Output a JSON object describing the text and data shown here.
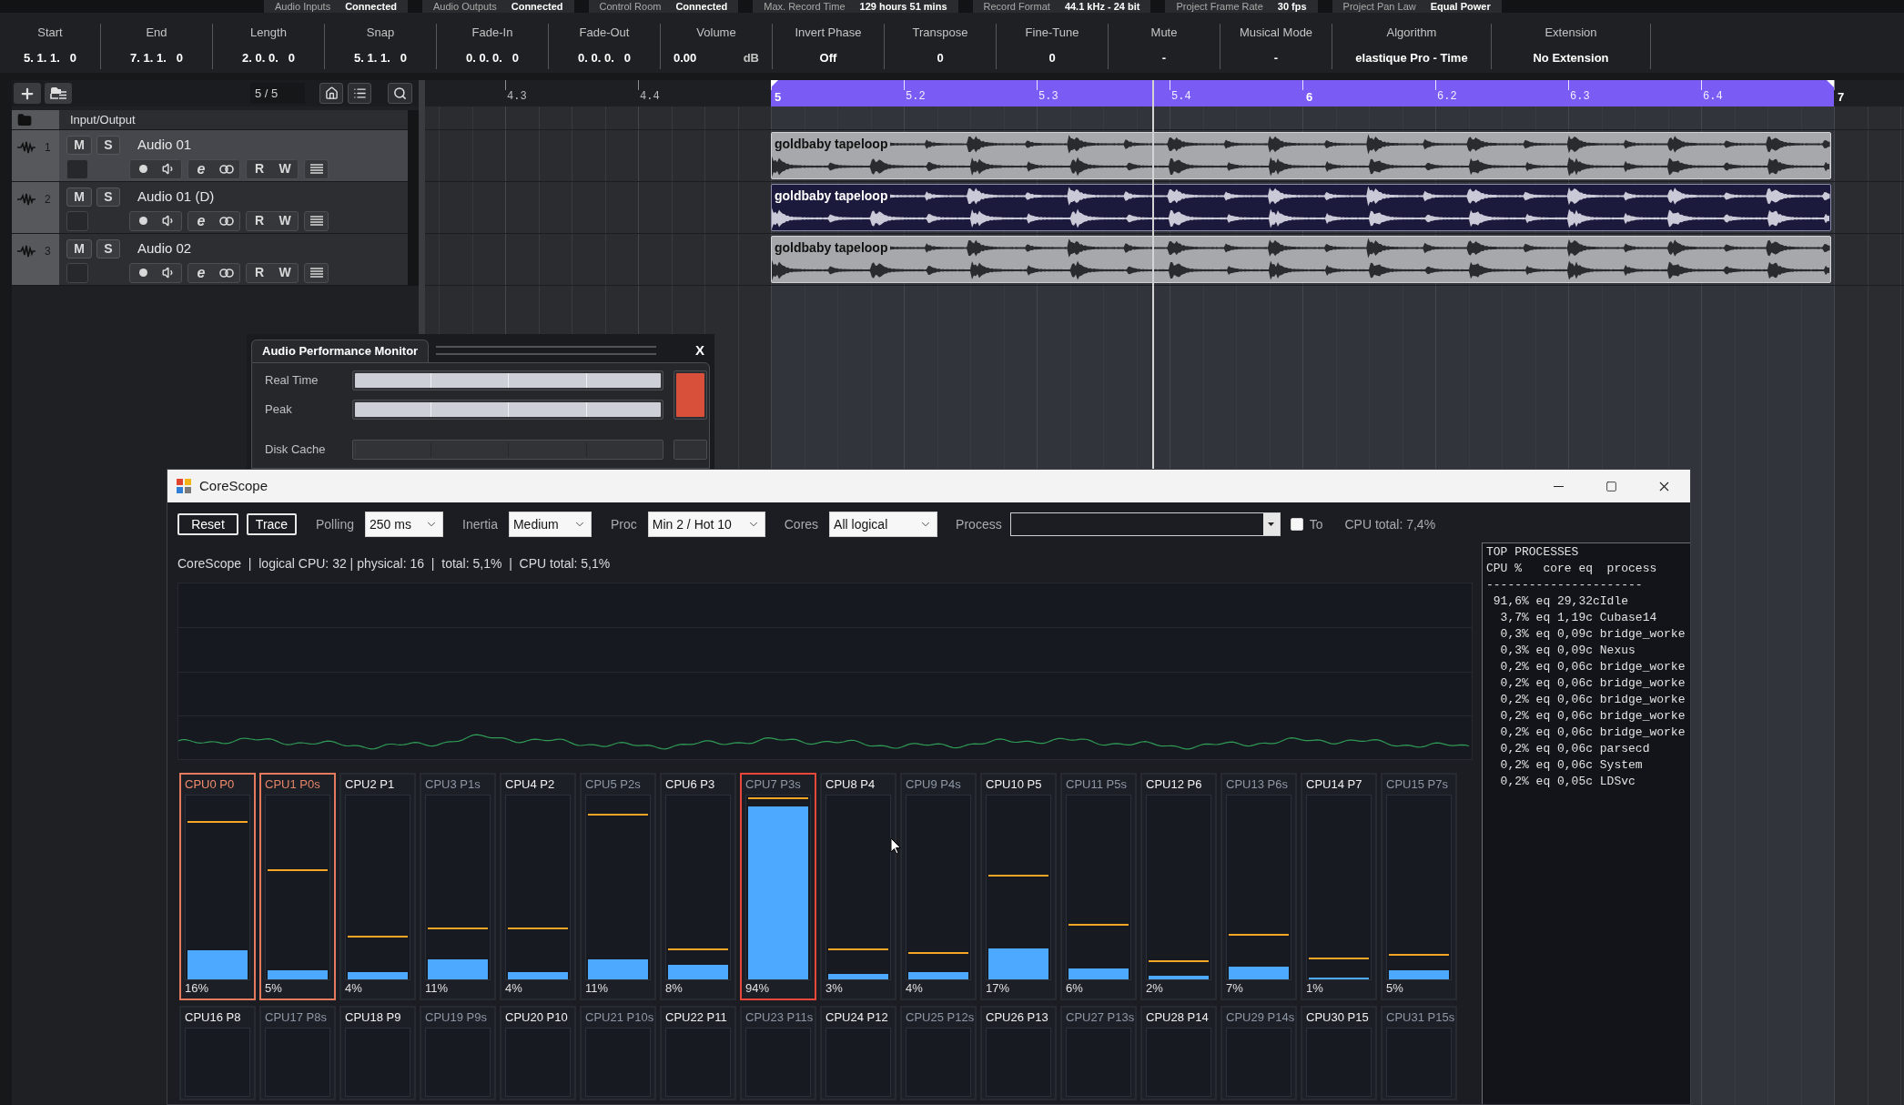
{
  "status_strip": [
    {
      "label": "Audio Inputs",
      "value": "Connected"
    },
    {
      "label": "Audio Outputs",
      "value": "Connected"
    },
    {
      "label": "Control Room",
      "value": "Connected"
    },
    {
      "label": "Max. Record Time",
      "value": "129 hours 51 mins"
    },
    {
      "label": "Record Format",
      "value": "44.1 kHz - 24 bit"
    },
    {
      "label": "Project Frame Rate",
      "value": "30 fps"
    },
    {
      "label": "Project Pan Law",
      "value": "Equal Power"
    }
  ],
  "info_line": [
    {
      "label": "Start",
      "value": "5. 1. 1.   0"
    },
    {
      "label": "End",
      "value": "7. 1. 1.   0"
    },
    {
      "label": "Length",
      "value": "2. 0. 0.   0"
    },
    {
      "label": "Snap",
      "value": "5. 1. 1.   0"
    },
    {
      "label": "Fade-In",
      "value": "0. 0. 0.   0"
    },
    {
      "label": "Fade-Out",
      "value": "0. 0. 0.   0"
    },
    {
      "label": "Volume",
      "value": "0.00",
      "unit": "dB"
    },
    {
      "label": "Invert Phase",
      "value": "Off"
    },
    {
      "label": "Transpose",
      "value": "0"
    },
    {
      "label": "Fine-Tune",
      "value": "0"
    },
    {
      "label": "Mute",
      "value": "-"
    },
    {
      "label": "Musical Mode",
      "value": "-"
    },
    {
      "label": "Algorithm",
      "value": "elastique Pro - Time"
    },
    {
      "label": "Extension",
      "value": "No Extension"
    }
  ],
  "project": {
    "track_count": "5 / 5",
    "folder_track": {
      "name": "Input/Output"
    },
    "tracks": [
      {
        "number": "1",
        "name": "Audio 01",
        "selected": true,
        "mute": "M",
        "solo": "S",
        "edit": "e",
        "read": "R",
        "write": "W"
      },
      {
        "number": "2",
        "name": "Audio 01 (D)",
        "selected": false,
        "mute": "M",
        "solo": "S",
        "edit": "e",
        "read": "R",
        "write": "W"
      },
      {
        "number": "3",
        "name": "Audio 02",
        "selected": false,
        "mute": "M",
        "solo": "S",
        "edit": "e",
        "read": "R",
        "write": "W"
      }
    ],
    "ruler": [
      {
        "label": "4.3",
        "kind": "beat",
        "in_cycle": false
      },
      {
        "label": "4.4",
        "kind": "beat",
        "in_cycle": false
      },
      {
        "label": "5",
        "kind": "bar",
        "in_cycle": true
      },
      {
        "label": "5.2",
        "kind": "beat",
        "in_cycle": true
      },
      {
        "label": "5.3",
        "kind": "beat",
        "in_cycle": true
      },
      {
        "label": "5.4",
        "kind": "beat",
        "in_cycle": true
      },
      {
        "label": "6",
        "kind": "bar",
        "in_cycle": true
      },
      {
        "label": "6.2",
        "kind": "beat",
        "in_cycle": true
      },
      {
        "label": "6.3",
        "kind": "beat",
        "in_cycle": true
      },
      {
        "label": "6.4",
        "kind": "beat",
        "in_cycle": true
      },
      {
        "label": "7",
        "kind": "bar",
        "in_cycle": false
      }
    ],
    "events": [
      {
        "name": "goldbaby tapeloop",
        "selected": false
      },
      {
        "name": "goldbaby tapeloop",
        "selected": true
      },
      {
        "name": "goldbaby tapeloop",
        "selected": false
      }
    ]
  },
  "performance_monitor": {
    "title": "Audio Performance Monitor",
    "close": "X",
    "groups": [
      {
        "meters": [
          {
            "label": "Real Time",
            "level": 1
          },
          {
            "label": "Peak",
            "level": 1
          }
        ],
        "overload": true
      },
      {
        "meters": [
          {
            "label": "Disk Cache",
            "level": 0
          }
        ],
        "overload": false
      }
    ]
  },
  "corescope": {
    "title": "CoreScope",
    "toolbar": {
      "buttons": [
        "Reset",
        "Trace"
      ],
      "selects": [
        {
          "label": "Polling",
          "value": "250 ms"
        },
        {
          "label": "Inertia",
          "value": "Medium"
        },
        {
          "label": "Proc",
          "value": "Min 2 / Hot 10"
        },
        {
          "label": "Cores",
          "value": "All logical"
        }
      ],
      "process": {
        "label": "Process"
      },
      "to": {
        "label": "To",
        "checked": false
      },
      "cpu_total": "CPU total: 7,4%"
    },
    "summary": "CoreScope  |  logical CPU: 32 | physical: 16  |  total: 5,1%  |  CPU total: 5,1%",
    "cores": [
      {
        "label": "CPU0 P0",
        "secondary": false,
        "warning": true,
        "critical": false,
        "level": 0.16,
        "peak": {
          "level": 0.85
        },
        "reading": "16%"
      },
      {
        "label": "CPU1 P0s",
        "secondary": true,
        "warning": true,
        "critical": false,
        "level": 0.05,
        "peak": {
          "level": 0.59
        },
        "reading": "5%"
      },
      {
        "label": "CPU2 P1",
        "secondary": false,
        "warning": false,
        "critical": false,
        "level": 0.04,
        "peak": {
          "level": 0.23
        },
        "reading": "4%"
      },
      {
        "label": "CPU3 P1s",
        "secondary": true,
        "warning": false,
        "critical": false,
        "level": 0.11,
        "peak": {
          "level": 0.27
        },
        "reading": "11%"
      },
      {
        "label": "CPU4 P2",
        "secondary": false,
        "warning": false,
        "critical": false,
        "level": 0.04,
        "peak": {
          "level": 0.27
        },
        "reading": "4%"
      },
      {
        "label": "CPU5 P2s",
        "secondary": true,
        "warning": false,
        "critical": false,
        "level": 0.11,
        "peak": {
          "level": 0.89
        },
        "reading": "11%"
      },
      {
        "label": "CPU6 P3",
        "secondary": false,
        "warning": false,
        "critical": false,
        "level": 0.08,
        "peak": {
          "level": 0.16
        },
        "reading": "8%"
      },
      {
        "label": "CPU7 P3s",
        "secondary": true,
        "warning": false,
        "critical": true,
        "level": 0.94,
        "peak": {
          "level": 0.98
        },
        "reading": "94%"
      },
      {
        "label": "CPU8 P4",
        "secondary": false,
        "warning": false,
        "critical": false,
        "level": 0.03,
        "peak": {
          "level": 0.16
        },
        "reading": "3%"
      },
      {
        "label": "CPU9 P4s",
        "secondary": true,
        "warning": false,
        "critical": false,
        "level": 0.04,
        "peak": {
          "level": 0.14
        },
        "reading": "4%"
      },
      {
        "label": "CPU10 P5",
        "secondary": false,
        "warning": false,
        "critical": false,
        "level": 0.17,
        "peak": {
          "level": 0.56
        },
        "reading": "17%"
      },
      {
        "label": "CPU11 P5s",
        "secondary": true,
        "warning": false,
        "critical": false,
        "level": 0.06,
        "peak": {
          "level": 0.29
        },
        "reading": "6%"
      },
      {
        "label": "CPU12 P6",
        "secondary": false,
        "warning": false,
        "critical": false,
        "level": 0.02,
        "peak": {
          "level": 0.095
        },
        "reading": "2%"
      },
      {
        "label": "CPU13 P6s",
        "secondary": true,
        "warning": false,
        "critical": false,
        "level": 0.07,
        "peak": {
          "level": 0.24
        },
        "reading": "7%"
      },
      {
        "label": "CPU14 P7",
        "secondary": false,
        "warning": false,
        "critical": false,
        "level": 0.01,
        "peak": {
          "level": 0.11
        },
        "reading": "1%"
      },
      {
        "label": "CPU15 P7s",
        "secondary": true,
        "warning": false,
        "critical": false,
        "level": 0.05,
        "peak": {
          "level": 0.13
        },
        "reading": "5%"
      },
      {
        "label": "CPU16 P8",
        "secondary": false,
        "warning": false,
        "critical": false
      },
      {
        "label": "CPU17 P8s",
        "secondary": true,
        "warning": false,
        "critical": false
      },
      {
        "label": "CPU18 P9",
        "secondary": false,
        "warning": false,
        "critical": false
      },
      {
        "label": "CPU19 P9s",
        "secondary": true,
        "warning": false,
        "critical": false
      },
      {
        "label": "CPU20 P10",
        "secondary": false,
        "warning": false,
        "critical": false
      },
      {
        "label": "CPU21 P10s",
        "secondary": true,
        "warning": false,
        "critical": false
      },
      {
        "label": "CPU22 P11",
        "secondary": false,
        "warning": false,
        "critical": false
      },
      {
        "label": "CPU23 P11s",
        "secondary": true,
        "warning": false,
        "critical": false
      },
      {
        "label": "CPU24 P12",
        "secondary": false,
        "warning": false,
        "critical": false
      },
      {
        "label": "CPU25 P12s",
        "secondary": true,
        "warning": false,
        "critical": false
      },
      {
        "label": "CPU26 P13",
        "secondary": false,
        "warning": false,
        "critical": false
      },
      {
        "label": "CPU27 P13s",
        "secondary": true,
        "warning": false,
        "critical": false
      },
      {
        "label": "CPU28 P14",
        "secondary": false,
        "warning": false,
        "critical": false
      },
      {
        "label": "CPU29 P14s",
        "secondary": true,
        "warning": false,
        "critical": false
      },
      {
        "label": "CPU30 P15",
        "secondary": false,
        "warning": false,
        "critical": false
      },
      {
        "label": "CPU31 P15s",
        "secondary": true,
        "warning": false,
        "critical": false
      }
    ],
    "top_processes": {
      "title": "TOP PROCESSES",
      "header": "CPU %   core eq  process",
      "rule": "----------------------",
      "rows": [
        " 91,6% eq 29,32cIdle",
        "  3,7% eq 1,19c Cubase14",
        "  0,3% eq 0,09c bridge_worke",
        "  0,3% eq 0,09c Nexus",
        "  0,2% eq 0,06c bridge_worke",
        "  0,2% eq 0,06c bridge_worke",
        "  0,2% eq 0,06c bridge_worke",
        "  0,2% eq 0,06c bridge_worke",
        "  0,2% eq 0,06c bridge_worke",
        "  0,2% eq 0,06c parsecd",
        "  0,2% eq 0,06c System",
        "  0,2% eq 0,05c LDSvc"
      ]
    }
  }
}
